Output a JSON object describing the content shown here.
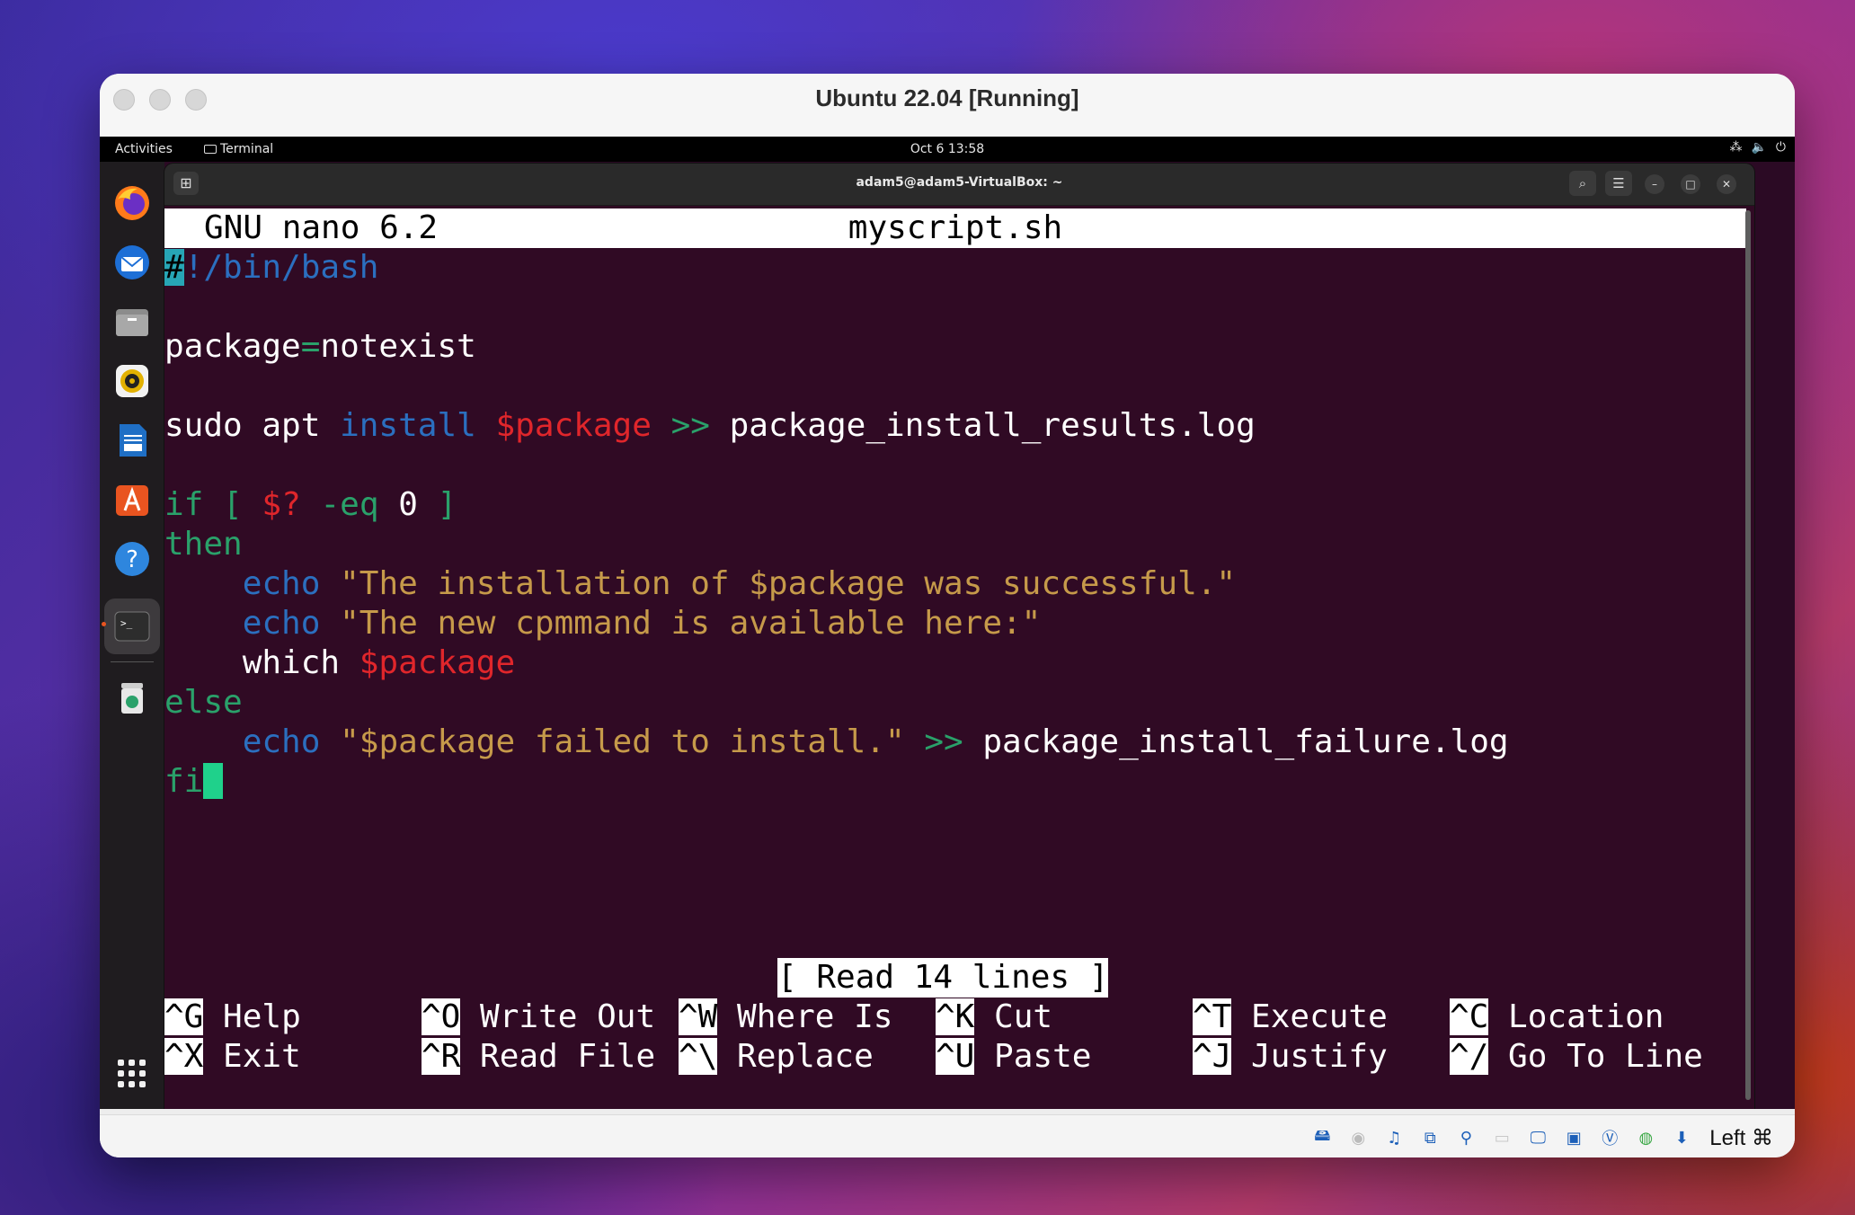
{
  "vbox": {
    "title": "Ubuntu 22.04 [Running]",
    "host_key": "Left ⌘"
  },
  "topbar": {
    "activities": "Activities",
    "app": "Terminal",
    "clock": "Oct 6  13:58"
  },
  "dock": {
    "items": [
      "firefox-icon",
      "thunderbird-icon",
      "files-icon",
      "rhythmbox-icon",
      "libreoffice-writer-icon",
      "app-center-icon",
      "help-icon",
      "terminal-icon",
      "trash-icon"
    ]
  },
  "terminal": {
    "title": "adam5@adam5-VirtualBox: ~"
  },
  "nano": {
    "version": "GNU nano 6.2",
    "filename": "myscript.sh",
    "status": "[ Read 14 lines ]",
    "shortcuts": [
      {
        "key": "^G",
        "label": "Help"
      },
      {
        "key": "^O",
        "label": "Write Out"
      },
      {
        "key": "^W",
        "label": "Where Is"
      },
      {
        "key": "^K",
        "label": "Cut"
      },
      {
        "key": "^T",
        "label": "Execute"
      },
      {
        "key": "^C",
        "label": "Location"
      },
      {
        "key": "^X",
        "label": "Exit"
      },
      {
        "key": "^R",
        "label": "Read File"
      },
      {
        "key": "^\\",
        "label": "Replace"
      },
      {
        "key": "^U",
        "label": "Paste"
      },
      {
        "key": "^J",
        "label": "Justify"
      },
      {
        "key": "^/",
        "label": "Go To Line"
      }
    ],
    "code": {
      "l1a": "#",
      "l1b": "!/bin/bash",
      "l3a": "package",
      "l3b": "=",
      "l3c": "notexist",
      "l5a": "sudo apt ",
      "l5b": "install",
      "l5c": "$package",
      "l5d": ">>",
      "l5e": "package_install_results.log",
      "l7a": "if",
      "l7b": "[",
      "l7c": "$?",
      "l7d": "-eq",
      "l7e": "0",
      "l7f": "]",
      "l8": "then",
      "l9a": "echo",
      "l9b": "\"The installation of $package was successful.\"",
      "l10a": "echo",
      "l10b": "\"The new cpmmand is available here:\"",
      "l11a": "which ",
      "l11b": "$package",
      "l12": "else",
      "l13a": "echo",
      "l13b": "\"$package failed to install.\"",
      "l13c": ">>",
      "l13d": "package_install_failure.log",
      "l14": "fi"
    }
  },
  "colors": {
    "terminal_bg": "#300a24",
    "keyword": "#2aa16a",
    "builtin": "#2b6fbf",
    "variable": "#e0262b",
    "string": "#c69a4a",
    "cursor": "#1fd18b"
  }
}
